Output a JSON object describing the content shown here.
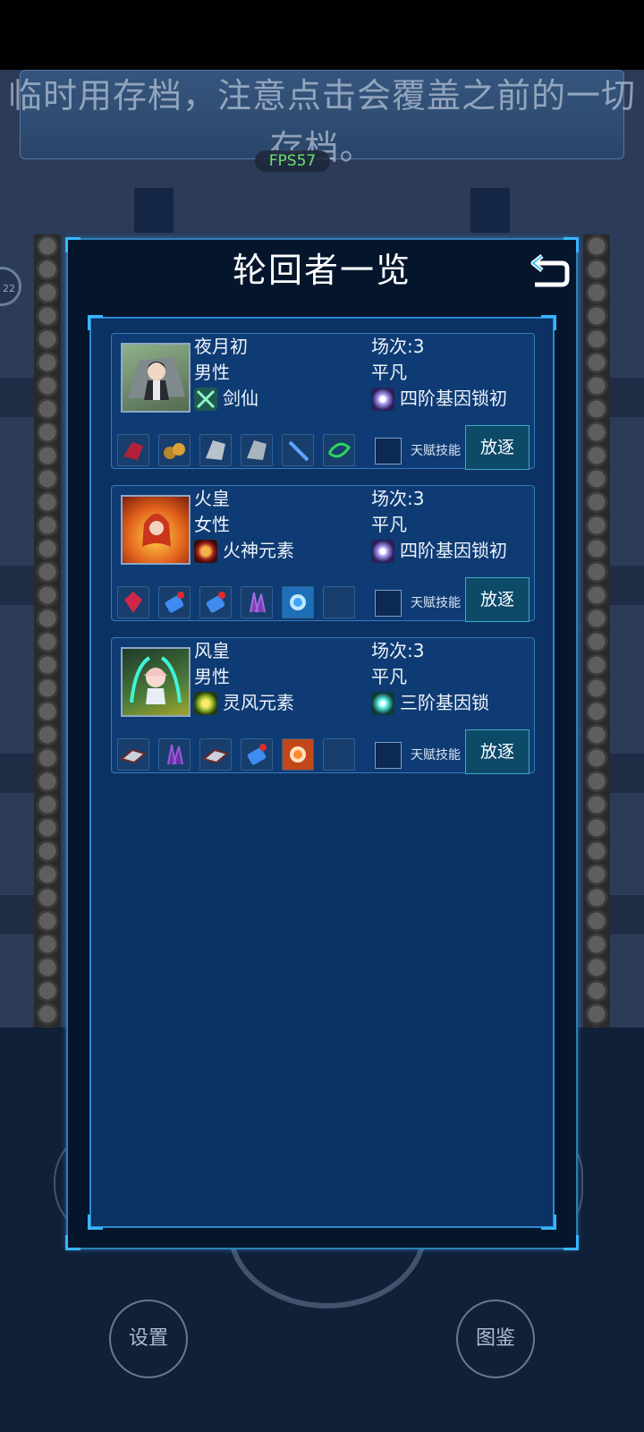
{
  "banner": {
    "text": "临时用存档，注意点击会覆盖之前的一切存档。"
  },
  "fps": "FPS57",
  "left_badge": "22",
  "modal": {
    "title": "轮回者一览"
  },
  "characters": [
    {
      "name": "夜月初",
      "gender": "男性",
      "class_label": "剑仙",
      "session": "场次:3",
      "rank": "平凡",
      "gene_label": "四阶基因锁初",
      "talent_label": "天赋技能",
      "expel_label": "放逐",
      "avatar_icon": "swordsman-portrait-icon",
      "class_icon": "crossed-swords-icon",
      "gene_icon": "purple-star-icon",
      "items": [
        "red-crystal-icon",
        "gold-ore-icon",
        "silver-ore-icon",
        "silver-ore-icon",
        "blue-blade-icon",
        "green-spiral-icon"
      ]
    },
    {
      "name": "火皇",
      "gender": "女性",
      "class_label": "火神元素",
      "session": "场次:3",
      "rank": "平凡",
      "gene_label": "四阶基因锁初",
      "talent_label": "天赋技能",
      "expel_label": "放逐",
      "avatar_icon": "fire-empress-portrait-icon",
      "class_icon": "fire-skull-icon",
      "gene_icon": "purple-star-icon",
      "items": [
        "red-gem-icon",
        "blue-potion-icon",
        "blue-potion-icon",
        "purple-crystal-icon",
        "blue-orb-icon",
        "empty-slot"
      ]
    },
    {
      "name": "风皇",
      "gender": "男性",
      "class_label": "灵风元素",
      "session": "场次:3",
      "rank": "平凡",
      "gene_label": "三阶基因锁",
      "talent_label": "天赋技能",
      "expel_label": "放逐",
      "avatar_icon": "wind-emperor-portrait-icon",
      "class_icon": "wind-swirl-icon",
      "gene_icon": "cyan-star-icon",
      "items": [
        "open-book-icon",
        "purple-crystal-icon",
        "open-book-icon",
        "blue-potion-icon",
        "orange-orb-icon",
        "empty-slot"
      ]
    }
  ],
  "bottom": {
    "settings_label": "设置",
    "codex_label": "图鉴"
  }
}
